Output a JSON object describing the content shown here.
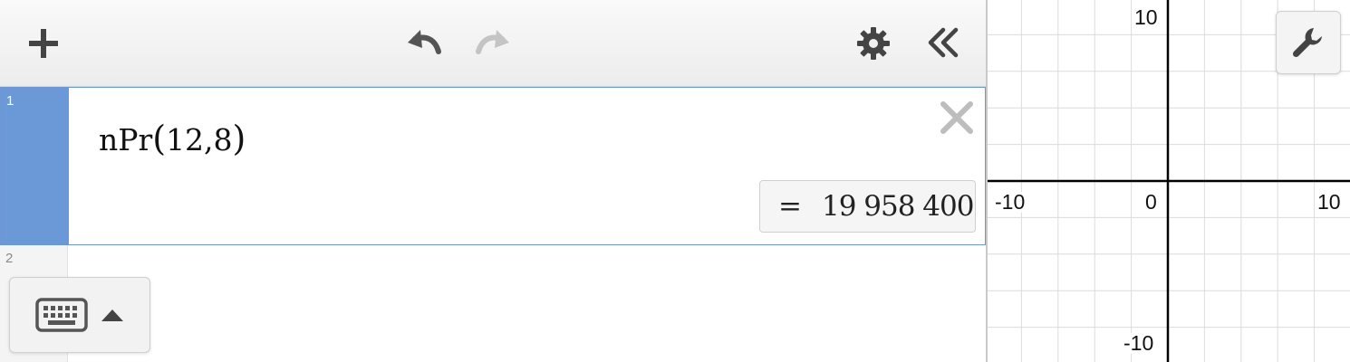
{
  "toolbar": {
    "add_icon": "plus-icon",
    "undo_icon": "undo-icon",
    "redo_icon": "redo-icon",
    "settings_icon": "gear-icon",
    "collapse_icon": "double-chevron-left-icon"
  },
  "expressions": [
    {
      "index": "1",
      "function": "nPr",
      "open_paren": "(",
      "args": "12,8",
      "close_paren": ")",
      "result_equals": "=",
      "result_value": "19 958 400"
    },
    {
      "index": "2"
    }
  ],
  "keyboard_toggle": {
    "icon": "keyboard-icon",
    "arrow_icon": "caret-up-icon"
  },
  "graph": {
    "x_ticks": [
      "-10",
      "0",
      "10"
    ],
    "y_ticks": [
      "10",
      "-10"
    ],
    "grid": true,
    "wrench_icon": "wrench-icon",
    "colors": {
      "axis": "#000000",
      "grid": "#dcdcdc",
      "active_row": "#6b98d6"
    }
  }
}
